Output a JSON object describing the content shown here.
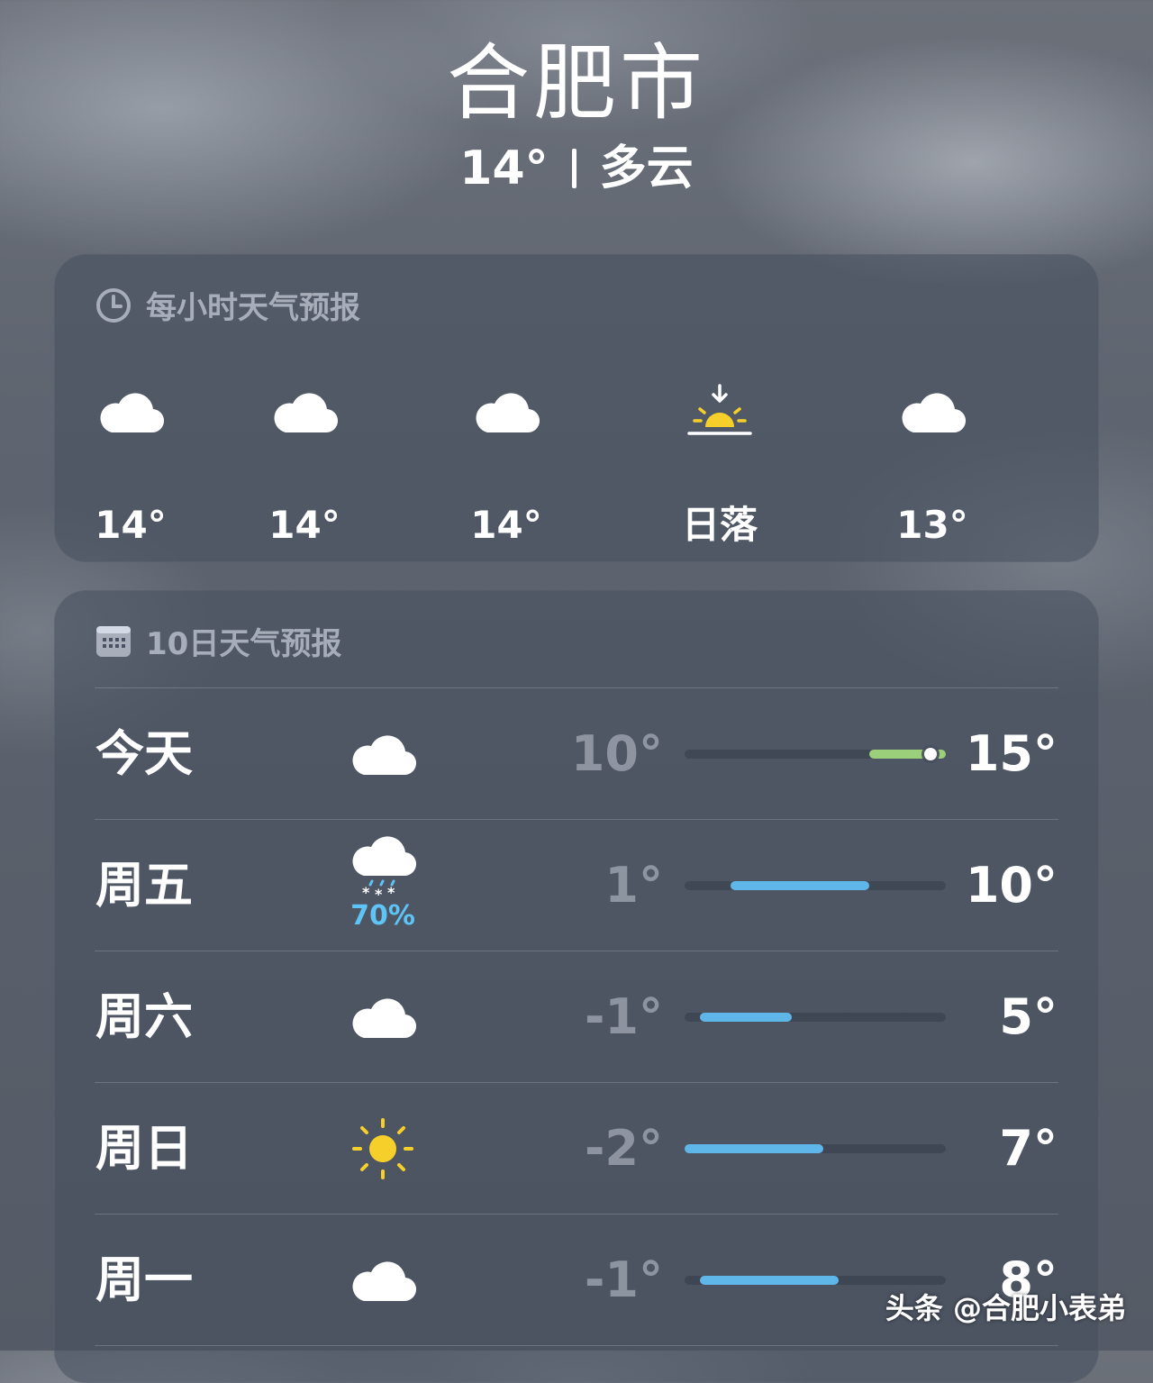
{
  "location": {
    "city": "合肥市",
    "current_temp": "14°",
    "condition": "多云"
  },
  "hourly": {
    "title": "每小时天气预报",
    "items": [
      {
        "icon": "cloud-icon",
        "temp": "14°"
      },
      {
        "icon": "cloud-icon",
        "temp": "14°"
      },
      {
        "icon": "cloud-icon",
        "temp": "14°"
      },
      {
        "icon": "sunset-icon",
        "temp": "日落"
      },
      {
        "icon": "cloud-icon",
        "temp": "13°"
      }
    ]
  },
  "daily": {
    "title": "10日天气预报",
    "range_min": -2,
    "range_max": 15,
    "days": [
      {
        "name": "今天",
        "icon": "cloud-icon",
        "precip": "",
        "low": "10°",
        "high": "15°",
        "low_value": 10,
        "high_value": 15,
        "current_value": 14,
        "bar_color": "#9ccf7a"
      },
      {
        "name": "周五",
        "icon": "snow-cloud-icon",
        "precip": "70%",
        "low": "1°",
        "high": "10°",
        "low_value": 1,
        "high_value": 10,
        "bar_color": "#5fb6e8"
      },
      {
        "name": "周六",
        "icon": "cloud-icon",
        "precip": "",
        "low": "-1°",
        "high": "5°",
        "low_value": -1,
        "high_value": 5,
        "bar_color": "#5fb6e8"
      },
      {
        "name": "周日",
        "icon": "sun-icon",
        "precip": "",
        "low": "-2°",
        "high": "7°",
        "low_value": -2,
        "high_value": 7,
        "bar_color": "#5fb6e8"
      },
      {
        "name": "周一",
        "icon": "cloud-icon",
        "precip": "",
        "low": "-1°",
        "high": "8°",
        "low_value": -1,
        "high_value": 8,
        "bar_color": "#5fb6e8"
      }
    ]
  },
  "watermark": "头条 @合肥小表弟"
}
